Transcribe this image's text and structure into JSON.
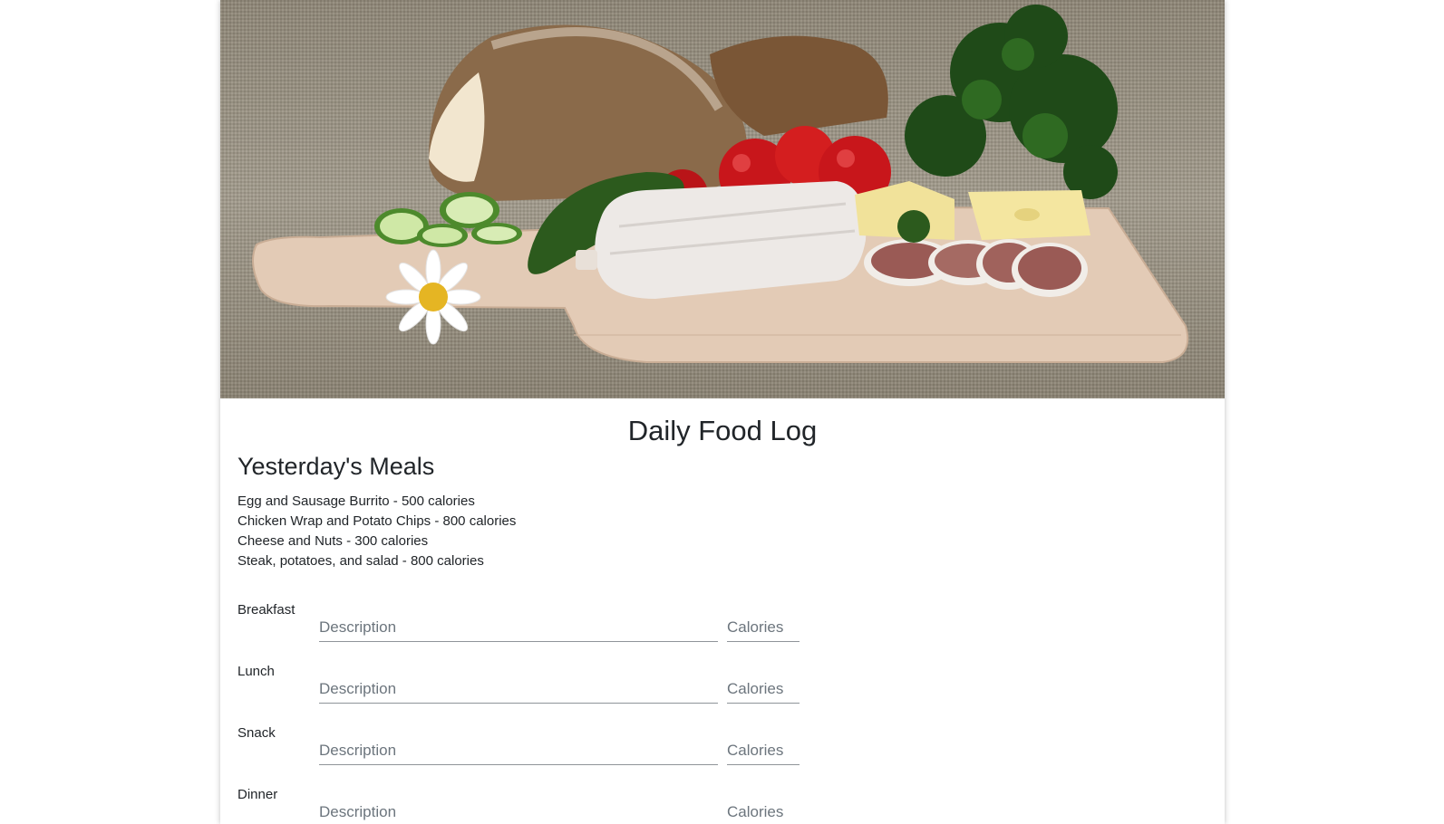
{
  "hero": {
    "alt": "Bread, cucumber, tomatoes, salami, cheese and parsley on a wooden cutting board"
  },
  "page": {
    "title": "Daily Food Log"
  },
  "yesterday": {
    "heading": "Yesterday's Meals",
    "meals": [
      "Egg and Sausage Burrito - 500 calories",
      "Chicken Wrap and Potato Chips - 800 calories",
      "Cheese and Nuts - 300 calories",
      "Steak, potatoes, and salad - 800 calories"
    ]
  },
  "form": {
    "rows": [
      {
        "label": "Breakfast",
        "description_placeholder": "Description",
        "calories_placeholder": "Calories"
      },
      {
        "label": "Lunch",
        "description_placeholder": "Description",
        "calories_placeholder": "Calories"
      },
      {
        "label": "Snack",
        "description_placeholder": "Description",
        "calories_placeholder": "Calories"
      },
      {
        "label": "Dinner",
        "description_placeholder": "Description",
        "calories_placeholder": "Calories"
      }
    ]
  }
}
